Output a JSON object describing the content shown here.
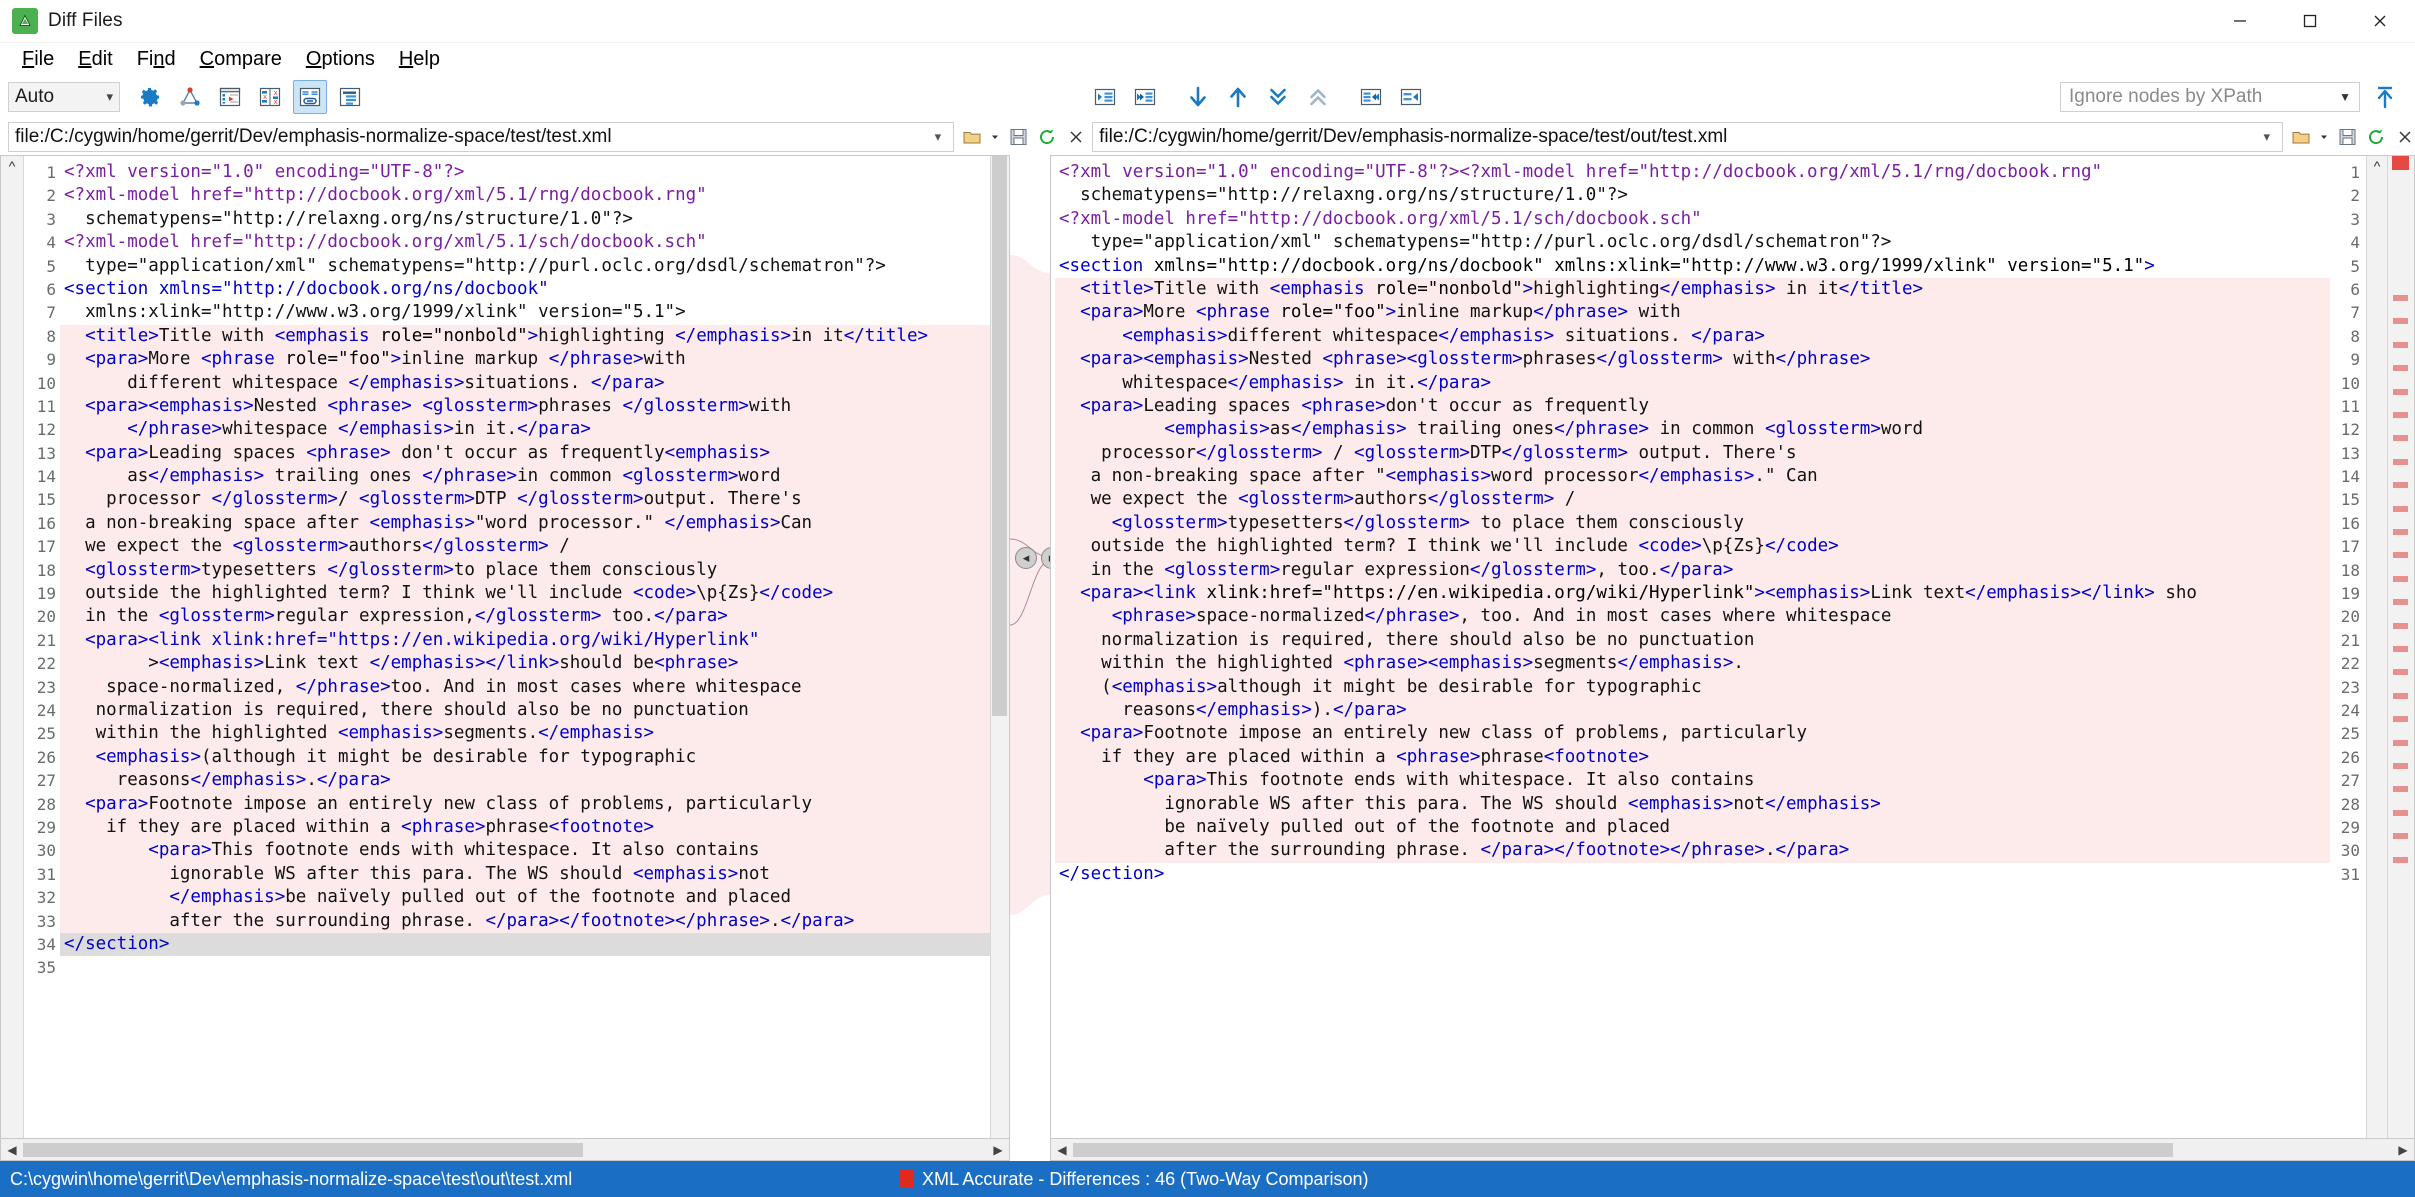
{
  "window": {
    "title": "Diff Files",
    "icon": "app-icon",
    "minimize_label": "Minimize",
    "maximize_label": "Maximize",
    "close_label": "Close"
  },
  "menu": {
    "items": [
      {
        "label": "File",
        "accel": "F"
      },
      {
        "label": "Edit",
        "accel": "E"
      },
      {
        "label": "Find",
        "accel": "n"
      },
      {
        "label": "Compare",
        "accel": "C"
      },
      {
        "label": "Options",
        "accel": "O"
      },
      {
        "label": "Help",
        "accel": "H"
      }
    ]
  },
  "toolbar": {
    "mode_select": {
      "value": "Auto",
      "options": [
        "Auto"
      ]
    },
    "left_buttons": [
      {
        "name": "settings-gear-icon",
        "tooltip": "Options"
      },
      {
        "name": "graph-nodes-icon",
        "tooltip": "Structure"
      },
      {
        "name": "run-compare-icon",
        "tooltip": "Compare"
      },
      {
        "name": "show-differences-icon",
        "tooltip": "Show differences"
      },
      {
        "name": "link-panes-icon",
        "tooltip": "Link panes",
        "active": true
      },
      {
        "name": "format-pretty-print-icon",
        "tooltip": "Pretty print"
      }
    ],
    "center_buttons": [
      {
        "name": "copy-left-icon",
        "tooltip": "Copy to left"
      },
      {
        "name": "copy-all-left-icon",
        "tooltip": "Copy all to left"
      },
      {
        "name": "next-difference-icon",
        "tooltip": "Next difference"
      },
      {
        "name": "previous-difference-icon",
        "tooltip": "Previous difference"
      },
      {
        "name": "last-difference-icon",
        "tooltip": "Last difference"
      },
      {
        "name": "first-difference-icon",
        "tooltip": "First difference"
      },
      {
        "name": "copy-all-right-icon",
        "tooltip": "Copy all to right"
      },
      {
        "name": "copy-right-icon",
        "tooltip": "Copy to right"
      }
    ],
    "xpath_filter": {
      "value": "",
      "placeholder": "Ignore nodes by XPath"
    },
    "apply_filter_icon": "apply-up-arrow-icon"
  },
  "left_pane": {
    "path": "file:/C:/cygwin/home/gerrit/Dev/emphasis-normalize-space/test/test.xml",
    "icons": [
      "open-folder-icon",
      "dropdown-caret-icon",
      "save-icon",
      "refresh-icon",
      "close-icon"
    ],
    "total_lines": 35,
    "lines": [
      {
        "n": 1,
        "state": "normal"
      },
      {
        "n": 2,
        "state": "normal"
      },
      {
        "n": 3,
        "state": "normal"
      },
      {
        "n": 4,
        "state": "normal"
      },
      {
        "n": 5,
        "state": "normal"
      },
      {
        "n": 6,
        "state": "normal"
      },
      {
        "n": 7,
        "state": "normal"
      },
      {
        "n": 8,
        "state": "diff"
      },
      {
        "n": 9,
        "state": "diff"
      },
      {
        "n": 10,
        "state": "diff"
      },
      {
        "n": 11,
        "state": "diff"
      },
      {
        "n": 12,
        "state": "diff"
      },
      {
        "n": 13,
        "state": "diff"
      },
      {
        "n": 14,
        "state": "diff"
      },
      {
        "n": 15,
        "state": "diff"
      },
      {
        "n": 16,
        "state": "diff"
      },
      {
        "n": 17,
        "state": "diff"
      },
      {
        "n": 18,
        "state": "diff"
      },
      {
        "n": 19,
        "state": "diff"
      },
      {
        "n": 20,
        "state": "diff"
      },
      {
        "n": 21,
        "state": "diff"
      },
      {
        "n": 22,
        "state": "diff"
      },
      {
        "n": 23,
        "state": "diff"
      },
      {
        "n": 24,
        "state": "diff"
      },
      {
        "n": 25,
        "state": "diff"
      },
      {
        "n": 26,
        "state": "diff"
      },
      {
        "n": 27,
        "state": "diff"
      },
      {
        "n": 28,
        "state": "diff"
      },
      {
        "n": 29,
        "state": "diff"
      },
      {
        "n": 30,
        "state": "diff"
      },
      {
        "n": 31,
        "state": "diff"
      },
      {
        "n": 32,
        "state": "diff"
      },
      {
        "n": 33,
        "state": "diff"
      },
      {
        "n": 34,
        "state": "gray"
      },
      {
        "n": 35,
        "state": "normal"
      }
    ],
    "text": [
      "<?xml version=\"1.0\" encoding=\"UTF-8\"?>",
      "<?xml-model href=\"http://docbook.org/xml/5.1/rng/docbook.rng\"",
      "  schematypens=\"http://relaxng.org/ns/structure/1.0\"?>",
      "<?xml-model href=\"http://docbook.org/xml/5.1/sch/docbook.sch\"",
      "  type=\"application/xml\" schematypens=\"http://purl.oclc.org/dsdl/schematron\"?>",
      "<section xmlns=\"http://docbook.org/ns/docbook\"",
      "  xmlns:xlink=\"http://www.w3.org/1999/xlink\" version=\"5.1\">",
      "  <title>Title with <emphasis role=\"nonbold\">highlighting </emphasis>in it</title>",
      "  <para>More <phrase role=\"foo\">inline markup </phrase>with",
      "      different whitespace </emphasis>situations. </para>",
      "  <para><emphasis>Nested <phrase> <glossterm>phrases </glossterm>with",
      "      </phrase>whitespace </emphasis>in it.</para>",
      "  <para>Leading spaces <phrase> don't occur as frequently<emphasis>",
      "      as</emphasis> trailing ones </phrase>in common <glossterm>word",
      "    processor </glossterm>/ <glossterm>DTP </glossterm>output. There's",
      "  a non-breaking space after <emphasis>\"word processor.\" </emphasis>Can",
      "  we expect the <glossterm>authors</glossterm> /",
      "  <glossterm>typesetters </glossterm>to place them consciously",
      "  outside the highlighted term? I think we'll include <code>\\p{Zs}</code>",
      "  in the <glossterm>regular expression,</glossterm> too.</para>",
      "  <para><link xlink:href=\"https://en.wikipedia.org/wiki/Hyperlink\"",
      "        ><emphasis>Link text </emphasis></link>should be<phrase>",
      "    space-normalized, </phrase>too. And in most cases where whitespace",
      "   normalization is required, there should also be no punctuation",
      "   within the highlighted <emphasis>segments.</emphasis>",
      "   <emphasis>(although it might be desirable for typographic",
      "     reasons</emphasis>.</para>",
      "  <para>Footnote impose an entirely new class of problems, particularly",
      "    if they are placed within a <phrase>phrase<footnote>",
      "        <para>This footnote ends with whitespace. It also contains",
      "          ignorable WS after this para. The WS should <emphasis>not",
      "          </emphasis>be naïvely pulled out of the footnote and placed",
      "          after the surrounding phrase. </para></footnote></phrase>.</para>",
      "</section>",
      ""
    ]
  },
  "right_pane": {
    "path": "file:/C:/cygwin/home/gerrit/Dev/emphasis-normalize-space/test/out/test.xml",
    "icons": [
      "open-folder-icon",
      "dropdown-caret-icon",
      "save-icon",
      "refresh-icon",
      "close-icon"
    ],
    "total_lines": 31,
    "lines": [
      {
        "n": 1,
        "state": "normal"
      },
      {
        "n": 2,
        "state": "normal"
      },
      {
        "n": 3,
        "state": "normal"
      },
      {
        "n": 4,
        "state": "normal"
      },
      {
        "n": 5,
        "state": "normal"
      },
      {
        "n": 6,
        "state": "diff"
      },
      {
        "n": 7,
        "state": "diff"
      },
      {
        "n": 8,
        "state": "diff"
      },
      {
        "n": 9,
        "state": "diff"
      },
      {
        "n": 10,
        "state": "diff"
      },
      {
        "n": 11,
        "state": "diff"
      },
      {
        "n": 12,
        "state": "diff"
      },
      {
        "n": 13,
        "state": "diff"
      },
      {
        "n": 14,
        "state": "diff"
      },
      {
        "n": 15,
        "state": "diff"
      },
      {
        "n": 16,
        "state": "diff"
      },
      {
        "n": 17,
        "state": "diff"
      },
      {
        "n": 18,
        "state": "diff"
      },
      {
        "n": 19,
        "state": "diff"
      },
      {
        "n": 20,
        "state": "diff"
      },
      {
        "n": 21,
        "state": "diff"
      },
      {
        "n": 22,
        "state": "diff"
      },
      {
        "n": 23,
        "state": "diff"
      },
      {
        "n": 24,
        "state": "diff"
      },
      {
        "n": 25,
        "state": "diff"
      },
      {
        "n": 26,
        "state": "diff"
      },
      {
        "n": 27,
        "state": "diff"
      },
      {
        "n": 28,
        "state": "diff"
      },
      {
        "n": 29,
        "state": "diff"
      },
      {
        "n": 30,
        "state": "diff"
      },
      {
        "n": 31,
        "state": "normal"
      }
    ],
    "text": [
      "<?xml version=\"1.0\" encoding=\"UTF-8\"?><?xml-model href=\"http://docbook.org/xml/5.1/rng/docbook.rng\"",
      "  schematypens=\"http://relaxng.org/ns/structure/1.0\"?>",
      "<?xml-model href=\"http://docbook.org/xml/5.1/sch/docbook.sch\"",
      "   type=\"application/xml\" schematypens=\"http://purl.oclc.org/dsdl/schematron\"?>",
      "<section xmlns=\"http://docbook.org/ns/docbook\" xmlns:xlink=\"http://www.w3.org/1999/xlink\" version=\"5.1\">",
      "  <title>Title with <emphasis role=\"nonbold\">highlighting</emphasis> in it</title>",
      "  <para>More <phrase role=\"foo\">inline markup</phrase> with",
      "      <emphasis>different whitespace</emphasis> situations. </para>",
      "  <para><emphasis>Nested <phrase><glossterm>phrases</glossterm> with</phrase>",
      "      whitespace</emphasis> in it.</para>",
      "  <para>Leading spaces <phrase>don't occur as frequently",
      "          <emphasis>as</emphasis> trailing ones</phrase> in common <glossterm>word",
      "    processor</glossterm> / <glossterm>DTP</glossterm> output. There's",
      "   a non-breaking space after \"<emphasis>word processor</emphasis>.\" Can",
      "   we expect the <glossterm>authors</glossterm> /",
      "     <glossterm>typesetters</glossterm> to place them consciously",
      "   outside the highlighted term? I think we'll include <code>\\p{Zs}</code>",
      "   in the <glossterm>regular expression</glossterm>, too.</para>",
      "  <para><link xlink:href=\"https://en.wikipedia.org/wiki/Hyperlink\"><emphasis>Link text</emphasis></link> sho",
      "     <phrase>space-normalized</phrase>, too. And in most cases where whitespace",
      "    normalization is required, there should also be no punctuation",
      "    within the highlighted <phrase><emphasis>segments</emphasis>.",
      "    (<emphasis>although it might be desirable for typographic",
      "      reasons</emphasis>).</para>",
      "  <para>Footnote impose an entirely new class of problems, particularly",
      "    if they are placed within a <phrase>phrase<footnote>",
      "        <para>This footnote ends with whitespace. It also contains",
      "          ignorable WS after this para. The WS should <emphasis>not</emphasis>",
      "          be naïvely pulled out of the footnote and placed",
      "          after the surrounding phrase. </para></footnote></phrase>.</para>",
      "</section>"
    ]
  },
  "merge_handles": [
    {
      "name": "merge-to-left-handle",
      "glyph": "◂"
    },
    {
      "name": "merge-to-right-handle",
      "glyph": "▸"
    }
  ],
  "statusbar": {
    "file_path": "C:\\cygwin\\home\\gerrit\\Dev\\emphasis-normalize-space\\test\\out\\test.xml",
    "status_indicator_color": "#e02a1f",
    "comparison_status": "XML Accurate - Differences : 46 (Two-Way Comparison)"
  },
  "colors": {
    "accent": "#1a6fc4",
    "diff_line_bg": "#fdeaea",
    "diff_inline_bg": "#f9c3c3",
    "selected_line_bg": "#dcdcdc",
    "toolbar_icon": "#1a6fc4"
  }
}
